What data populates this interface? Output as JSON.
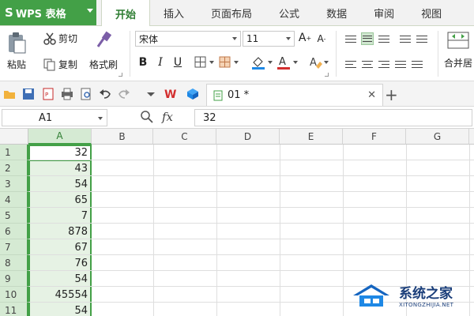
{
  "app": {
    "name": "WPS 表格",
    "logo": "S"
  },
  "menu_tabs": [
    "开始",
    "插入",
    "页面布局",
    "公式",
    "数据",
    "审阅",
    "视图"
  ],
  "active_tab": "开始",
  "ribbon": {
    "paste": "粘贴",
    "cut": "剪切",
    "copy": "复制",
    "format_painter": "格式刷",
    "font_name": "宋体",
    "font_size": "11",
    "bold": "B",
    "italic": "I",
    "underline": "U",
    "merge": "合并居"
  },
  "document": {
    "tab_name": "01 *"
  },
  "formula_bar": {
    "cell_ref": "A1",
    "fx": "fx",
    "value": "32"
  },
  "columns": [
    "A",
    "B",
    "C",
    "D",
    "E",
    "F",
    "G"
  ],
  "selected_column": "A",
  "rows": [
    {
      "num": "1",
      "a": "32"
    },
    {
      "num": "2",
      "a": "43"
    },
    {
      "num": "3",
      "a": "54"
    },
    {
      "num": "4",
      "a": "65"
    },
    {
      "num": "5",
      "a": "7"
    },
    {
      "num": "6",
      "a": "878"
    },
    {
      "num": "7",
      "a": "67"
    },
    {
      "num": "8",
      "a": "76"
    },
    {
      "num": "9",
      "a": "54"
    },
    {
      "num": "10",
      "a": "45554"
    },
    {
      "num": "11",
      "a": "54"
    }
  ],
  "watermark": {
    "cn": "系统之家",
    "en": "XITONGZHIJIA.NET"
  },
  "colors": {
    "accent": "#43a047",
    "selection": "#d5ead3"
  }
}
